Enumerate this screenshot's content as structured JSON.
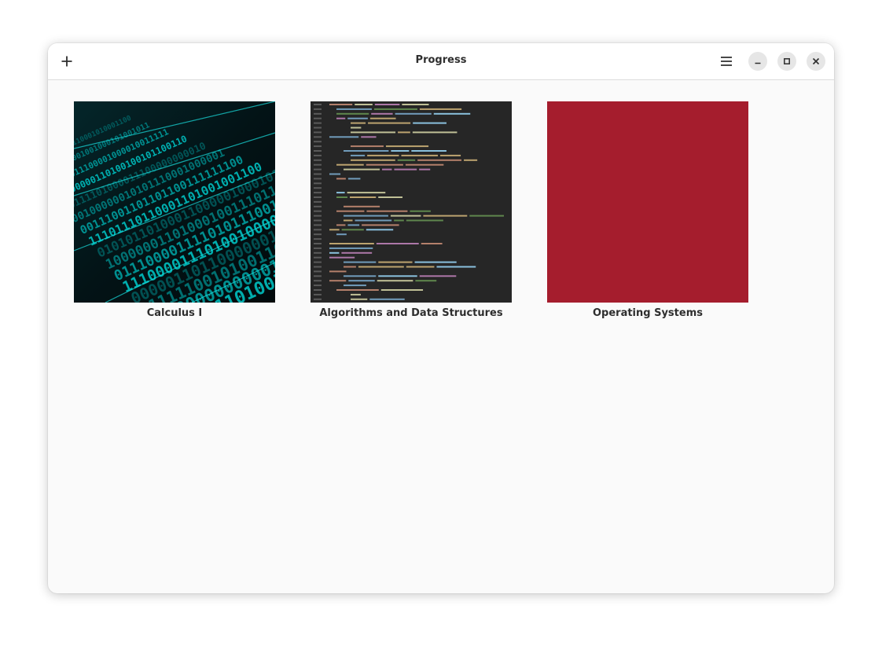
{
  "header": {
    "title": "Progress",
    "add_icon": "plus-icon",
    "menu_icon": "hamburger-menu-icon",
    "window_controls": [
      "minimize-icon",
      "maximize-icon",
      "close-icon"
    ]
  },
  "boards": [
    {
      "title": "Calculus I",
      "thumbnail": "binary-digits-cyan",
      "accent": "#00c8c8"
    },
    {
      "title": "Algorithms and Data Structures",
      "thumbnail": "source-code-dark",
      "accent": "#262626"
    },
    {
      "title": "Operating Systems",
      "thumbnail": "solid-color",
      "accent": "#a51d2d"
    }
  ]
}
